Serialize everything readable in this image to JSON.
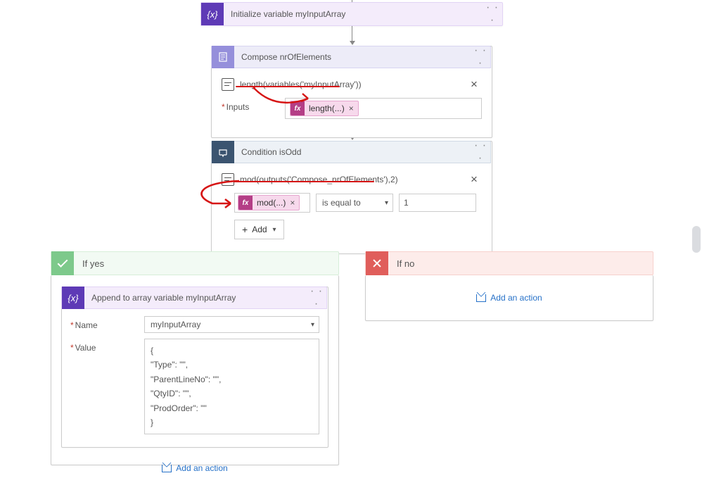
{
  "cards": {
    "init": {
      "title": "Initialize variable myInputArray"
    },
    "compose": {
      "title": "Compose nrOfElements",
      "comment": "length(variables('myInputArray'))",
      "input_label": "Inputs",
      "chip": "length(...)"
    },
    "condition": {
      "title": "Condition isOdd",
      "comment": "mod(outputs('Compose_nrOfElements'),2)",
      "chip": "mod(...)",
      "operator": "is equal to",
      "right_value": "1",
      "add_label": "Add"
    },
    "append": {
      "title": "Append to array variable myInputArray",
      "name_label": "Name",
      "name_value": "myInputArray",
      "value_label": "Value",
      "value_text": "{\n\"Type\": \"\",\n\"ParentLineNo\": \"\",\n\"QtyID\": \"\",\n\"ProdOrder\": \"\"\n}"
    }
  },
  "branches": {
    "yes": "If yes",
    "no": "If no"
  },
  "actions": {
    "add_action": "Add an action"
  },
  "glyphs": {
    "fx": "fx",
    "menu": "· · ·"
  }
}
